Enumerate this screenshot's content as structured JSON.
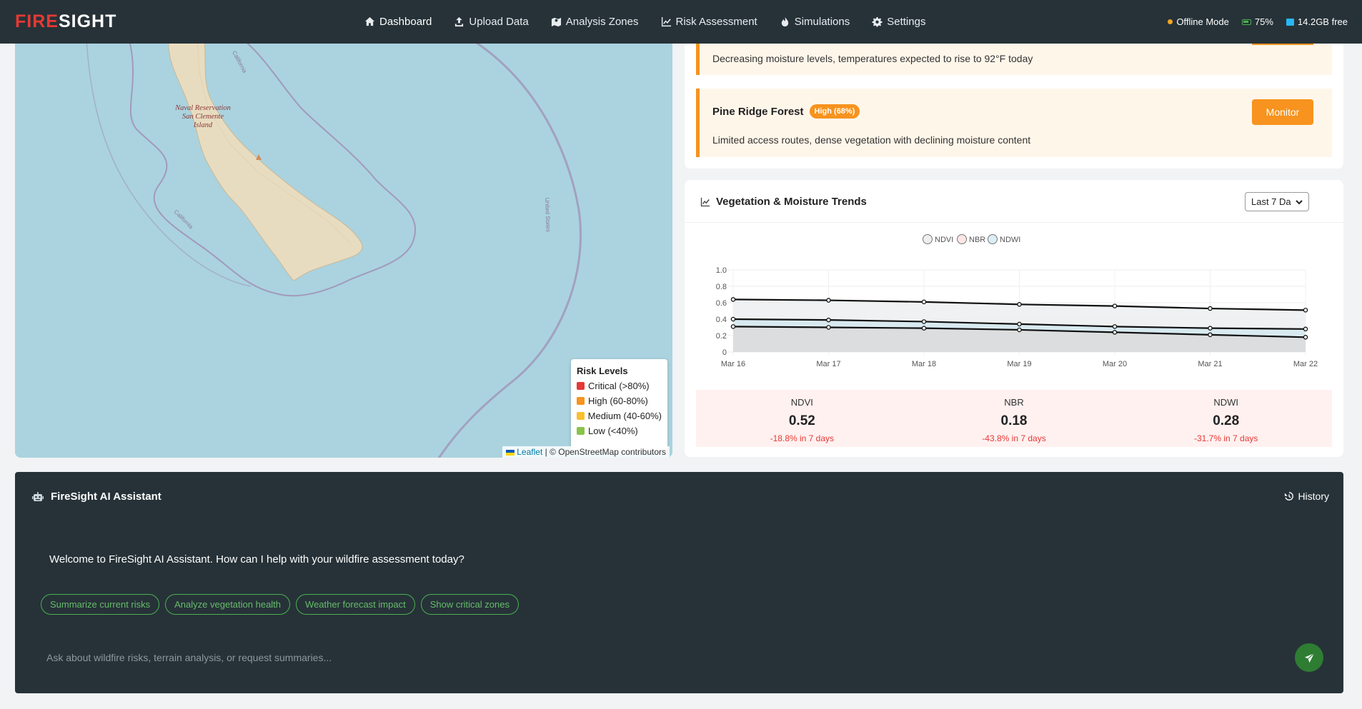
{
  "brand": {
    "part1": "FIRE",
    "part2": "SIGHT"
  },
  "nav": [
    {
      "label": "Dashboard",
      "icon": "home-icon",
      "active": true
    },
    {
      "label": "Upload Data",
      "icon": "upload-icon"
    },
    {
      "label": "Analysis Zones",
      "icon": "map-icon"
    },
    {
      "label": "Risk Assessment",
      "icon": "chart-line-icon"
    },
    {
      "label": "Simulations",
      "icon": "fire-icon"
    },
    {
      "label": "Settings",
      "icon": "gear-icon"
    }
  ],
  "status": {
    "mode": "Offline Mode",
    "battery": "75%",
    "storage": "14.2GB free",
    "colors": {
      "mode": "#f5a623",
      "battery": "#4caf50",
      "storage": "#29b6f6"
    }
  },
  "map": {
    "place_label": [
      "Naval Reservation",
      "San Clemente",
      "Island"
    ],
    "border_labels": [
      "California",
      "California",
      "United States"
    ],
    "legend": {
      "title": "Risk Levels",
      "items": [
        {
          "label": "Critical (>80%)",
          "color": "#e53935"
        },
        {
          "label": "High (60-80%)",
          "color": "#f7931e"
        },
        {
          "label": "Medium (40-60%)",
          "color": "#fbc02d"
        },
        {
          "label": "Low (<40%)",
          "color": "#8bc34a"
        }
      ]
    },
    "attribution": {
      "link": "Leaflet",
      "rest": "| © OpenStreetMap contributors"
    }
  },
  "alerts": {
    "partial_desc": "Decreasing moisture levels, temperatures expected to rise to 92°F today",
    "item": {
      "name": "Pine Ridge Forest",
      "badge": "High (68%)",
      "desc": "Limited access routes, dense vegetation with declining moisture content",
      "action": "Monitor"
    },
    "accent": "#f7931e"
  },
  "trends": {
    "title": "Vegetation & Moisture Trends",
    "range": "Last 7 Da",
    "metrics": [
      {
        "label": "NDVI",
        "value": "0.52",
        "change": "-18.8% in 7 days"
      },
      {
        "label": "NBR",
        "value": "0.18",
        "change": "-43.8% in 7 days"
      },
      {
        "label": "NDWI",
        "value": "0.28",
        "change": "-31.7% in 7 days"
      }
    ]
  },
  "chart_data": {
    "type": "area",
    "categories": [
      "Mar 16",
      "Mar 17",
      "Mar 18",
      "Mar 19",
      "Mar 20",
      "Mar 21",
      "Mar 22"
    ],
    "series": [
      {
        "name": "NDVI",
        "values": [
          0.64,
          0.63,
          0.61,
          0.58,
          0.56,
          0.53,
          0.51
        ],
        "fill": "#eef0f1"
      },
      {
        "name": "NBR",
        "values": [
          0.31,
          0.3,
          0.29,
          0.27,
          0.24,
          0.21,
          0.18
        ],
        "fill": "#dcdcdc"
      },
      {
        "name": "NDWI",
        "values": [
          0.4,
          0.39,
          0.37,
          0.34,
          0.31,
          0.29,
          0.28
        ],
        "fill": "#d6e9ef"
      }
    ],
    "legend_fills": {
      "NDVI": "#eceeef",
      "NBR": "#fde6e3",
      "NDWI": "#dcedf5"
    },
    "ylim": [
      0,
      1.0
    ],
    "yticks": [
      "0",
      "0.2",
      "0.4",
      "0.6",
      "0.8",
      "1.0"
    ],
    "grid": true,
    "legend": "top-center"
  },
  "assistant": {
    "title": "FireSight AI Assistant",
    "history": "History",
    "welcome": "Welcome to FireSight AI Assistant. How can I help with your wildfire assessment today?",
    "chips": [
      "Summarize current risks",
      "Analyze vegetation health",
      "Weather forecast impact",
      "Show critical zones"
    ],
    "placeholder": "Ask about wildfire risks, terrain analysis, or request summaries..."
  }
}
